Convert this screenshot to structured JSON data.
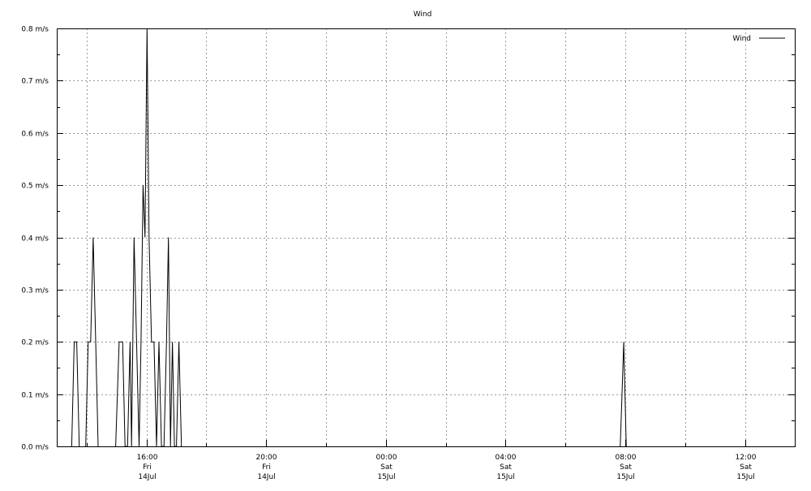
{
  "chart_data": {
    "type": "line",
    "title": "Wind",
    "xlabel": "",
    "ylabel": "",
    "grid": true,
    "legend_position": "top-right",
    "xlim": [
      "2006-07-14T13:00",
      "2006-07-15T13:40"
    ],
    "ylim": [
      0,
      0.8
    ],
    "y_ticks": [
      {
        "value": 0.0,
        "label": "0.0 m/s"
      },
      {
        "value": 0.1,
        "label": "0.1 m/s"
      },
      {
        "value": 0.2,
        "label": "0.2 m/s"
      },
      {
        "value": 0.3,
        "label": "0.3 m/s"
      },
      {
        "value": 0.4,
        "label": "0.4 m/s"
      },
      {
        "value": 0.5,
        "label": "0.5 m/s"
      },
      {
        "value": 0.6,
        "label": "0.6 m/s"
      },
      {
        "value": 0.7,
        "label": "0.7 m/s"
      },
      {
        "value": 0.8,
        "label": "0.8 m/s"
      }
    ],
    "x_ticks": [
      {
        "t": "2006-07-14T16:00",
        "time": "16:00",
        "weekday": "Fri",
        "date": "14Jul"
      },
      {
        "t": "2006-07-14T20:00",
        "time": "20:00",
        "weekday": "Fri",
        "date": "14Jul"
      },
      {
        "t": "2006-07-15T00:00",
        "time": "00:00",
        "weekday": "Sat",
        "date": "15Jul"
      },
      {
        "t": "2006-07-15T04:00",
        "time": "04:00",
        "weekday": "Sat",
        "date": "15Jul"
      },
      {
        "t": "2006-07-15T08:00",
        "time": "08:00",
        "weekday": "Sat",
        "date": "15Jul"
      },
      {
        "t": "2006-07-15T12:00",
        "time": "12:00",
        "weekday": "Sat",
        "date": "15Jul"
      }
    ],
    "x_minor_ticks": [
      "2006-07-14T14:00",
      "2006-07-14T18:00",
      "2006-07-14T22:00",
      "2006-07-15T02:00",
      "2006-07-15T06:00",
      "2006-07-15T10:00"
    ],
    "series": [
      {
        "name": "Wind",
        "color": "#000000",
        "points": [
          {
            "x": "2006-07-14T13:00",
            "y": null
          },
          {
            "x": "2006-07-14T13:30",
            "y": 0.0
          },
          {
            "x": "2006-07-14T13:35",
            "y": 0.2
          },
          {
            "x": "2006-07-14T13:40",
            "y": 0.2
          },
          {
            "x": "2006-07-14T13:45",
            "y": 0.0
          },
          {
            "x": "2006-07-14T13:50",
            "y": null
          },
          {
            "x": "2006-07-14T13:58",
            "y": 0.0
          },
          {
            "x": "2006-07-14T14:03",
            "y": 0.2
          },
          {
            "x": "2006-07-14T14:08",
            "y": 0.2
          },
          {
            "x": "2006-07-14T14:13",
            "y": 0.4
          },
          {
            "x": "2006-07-14T14:18",
            "y": 0.2
          },
          {
            "x": "2006-07-14T14:23",
            "y": 0.0
          },
          {
            "x": "2006-07-14T14:28",
            "y": null
          },
          {
            "x": "2006-07-14T14:58",
            "y": 0.0
          },
          {
            "x": "2006-07-14T15:05",
            "y": 0.2
          },
          {
            "x": "2006-07-14T15:12",
            "y": 0.2
          },
          {
            "x": "2006-07-14T15:17",
            "y": 0.0
          },
          {
            "x": "2006-07-14T15:22",
            "y": 0.0
          },
          {
            "x": "2006-07-14T15:27",
            "y": 0.2
          },
          {
            "x": "2006-07-14T15:30",
            "y": 0.0
          },
          {
            "x": "2006-07-14T15:35",
            "y": 0.4
          },
          {
            "x": "2006-07-14T15:40",
            "y": 0.2
          },
          {
            "x": "2006-07-14T15:45",
            "y": 0.0
          },
          {
            "x": "2006-07-14T15:49",
            "y": 0.2
          },
          {
            "x": "2006-07-14T15:53",
            "y": 0.5
          },
          {
            "x": "2006-07-14T15:57",
            "y": 0.4
          },
          {
            "x": "2006-07-14T16:01",
            "y": 0.8
          },
          {
            "x": "2006-07-14T16:05",
            "y": 0.4
          },
          {
            "x": "2006-07-14T16:10",
            "y": 0.2
          },
          {
            "x": "2006-07-14T16:15",
            "y": 0.2
          },
          {
            "x": "2006-07-14T16:20",
            "y": 0.0
          },
          {
            "x": "2006-07-14T16:25",
            "y": 0.2
          },
          {
            "x": "2006-07-14T16:30",
            "y": 0.0
          },
          {
            "x": "2006-07-14T16:35",
            "y": 0.0
          },
          {
            "x": "2006-07-14T16:40",
            "y": 0.2
          },
          {
            "x": "2006-07-14T16:44",
            "y": 0.4
          },
          {
            "x": "2006-07-14T16:48",
            "y": 0.0
          },
          {
            "x": "2006-07-14T16:52",
            "y": 0.2
          },
          {
            "x": "2006-07-14T16:56",
            "y": 0.0
          },
          {
            "x": "2006-07-14T17:00",
            "y": 0.0
          },
          {
            "x": "2006-07-14T17:05",
            "y": 0.2
          },
          {
            "x": "2006-07-14T17:10",
            "y": 0.0
          },
          {
            "x": "2006-07-14T17:14",
            "y": null
          },
          {
            "x": "2006-07-15T07:50",
            "y": 0.0
          },
          {
            "x": "2006-07-15T07:57",
            "y": 0.2
          },
          {
            "x": "2006-07-15T08:02",
            "y": 0.0
          }
        ]
      }
    ]
  }
}
